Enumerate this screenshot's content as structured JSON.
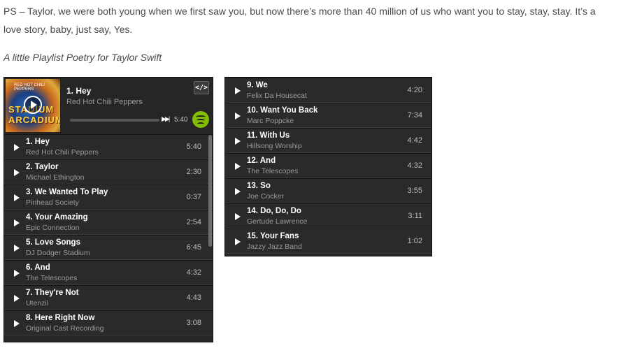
{
  "article": {
    "ps_text": "PS – Taylor, we were both young when we first saw you, but now there’s more than 40 million of us who want you to stay, stay, stay. It’s a love story, baby, just say, Yes.",
    "caption": "A little Playlist Poetry for Taylor Swift"
  },
  "player1": {
    "album_art": {
      "label_top": "RED HOT CHILI PEPPERS",
      "label_title": "STADIUM ARCADIUM"
    },
    "now_playing": {
      "title": "1. Hey",
      "artist": "Red Hot Chili Peppers",
      "time": "5:40",
      "progress": 0.0
    },
    "embed_label": "</>",
    "icons": {
      "play": "play-icon",
      "skip": "skip-forward-icon",
      "logo": "spotify-logo-icon",
      "embed": "code-icon"
    },
    "accent_color": "#84bd00",
    "tracks": [
      {
        "title": "1. Hey",
        "artist": "Red Hot Chili Peppers",
        "duration": "5:40"
      },
      {
        "title": "2. Taylor",
        "artist": "Michael Ethington",
        "duration": "2:30"
      },
      {
        "title": "3. We Wanted To Play",
        "artist": "Pinhead Society",
        "duration": "0:37"
      },
      {
        "title": "4. Your Amazing",
        "artist": "Epic Connection",
        "duration": "2:54"
      },
      {
        "title": "5. Love Songs",
        "artist": "DJ Dodger Stadium",
        "duration": "6:45"
      },
      {
        "title": "6. And",
        "artist": "The Telescopes",
        "duration": "4:32"
      },
      {
        "title": "7. They're Not",
        "artist": "Utenzil",
        "duration": "4:43"
      },
      {
        "title": "8. Here Right Now",
        "artist": "Original Cast Recording",
        "duration": "3:08"
      }
    ]
  },
  "player2": {
    "tracks": [
      {
        "title": "9. We",
        "artist": "Felix Da Housecat",
        "duration": "4:20"
      },
      {
        "title": "10. Want You Back",
        "artist": "Marc Poppcke",
        "duration": "7:34"
      },
      {
        "title": "11. With Us",
        "artist": "Hillsong Worship",
        "duration": "4:42"
      },
      {
        "title": "12. And",
        "artist": "The Telescopes",
        "duration": "4:32"
      },
      {
        "title": "13. So",
        "artist": "Joe Cocker",
        "duration": "3:55"
      },
      {
        "title": "14. Do, Do, Do",
        "artist": "Gertude Lawrence",
        "duration": "3:11"
      },
      {
        "title": "15. Your Fans",
        "artist": "Jazzy Jazz Band",
        "duration": "1:02"
      }
    ]
  }
}
